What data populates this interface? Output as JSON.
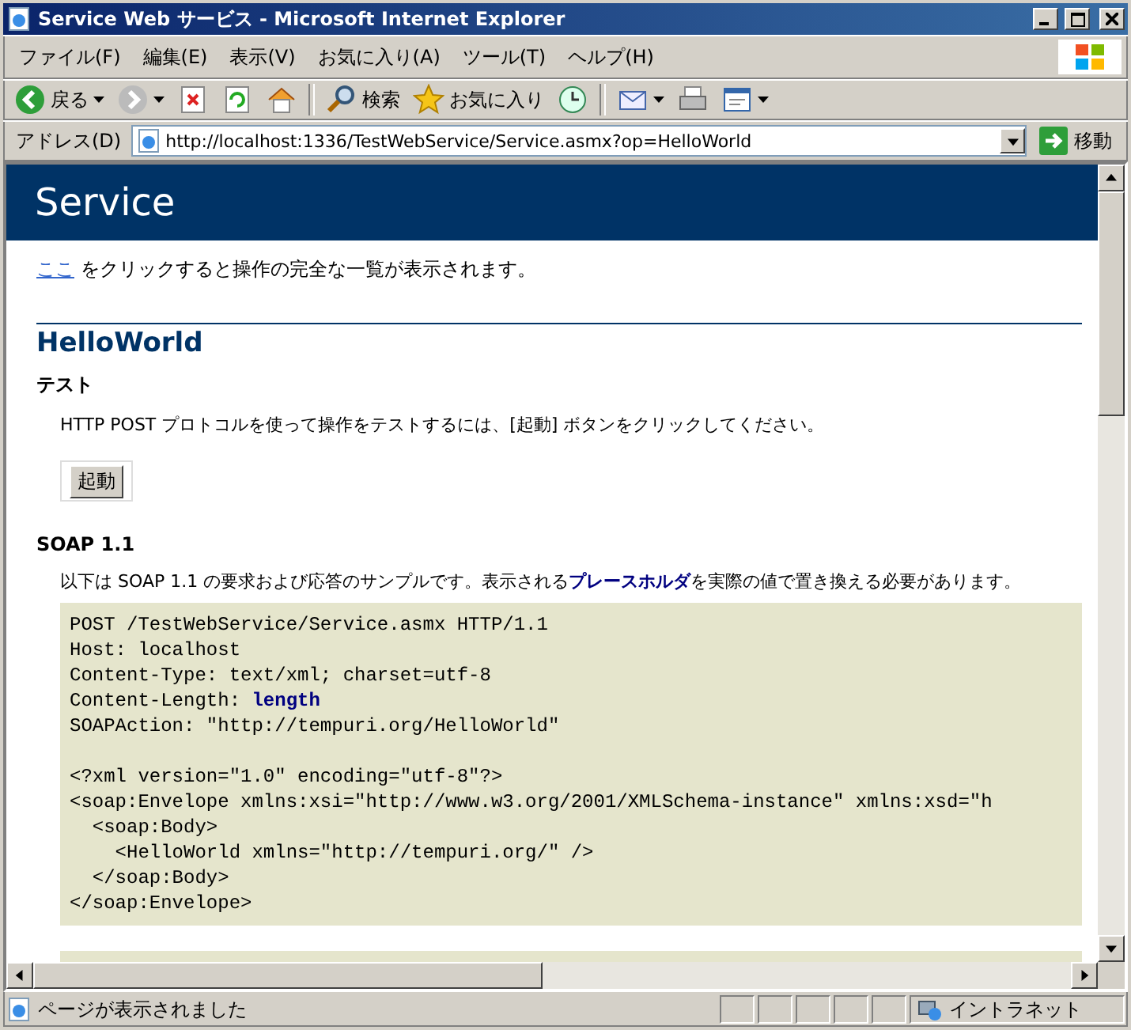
{
  "window": {
    "title": "Service Web サービス - Microsoft Internet Explorer"
  },
  "menu": [
    "ファイル(F)",
    "編集(E)",
    "表示(V)",
    "お気に入り(A)",
    "ツール(T)",
    "ヘルプ(H)"
  ],
  "toolbar": [
    {
      "kind": "back",
      "label": "戻る",
      "dropdown": true
    },
    {
      "kind": "forward",
      "dropdown": true
    },
    {
      "kind": "stop"
    },
    {
      "kind": "refresh"
    },
    {
      "kind": "home"
    },
    {
      "kind": "search",
      "label": "検索"
    },
    {
      "kind": "favorites",
      "label": "お気に入り"
    },
    {
      "kind": "history"
    },
    {
      "kind": "mail",
      "dropdown": true
    },
    {
      "kind": "print"
    },
    {
      "kind": "edit",
      "dropdown": true
    }
  ],
  "address": {
    "label": "アドレス(D)",
    "url": "http://localhost:1336/TestWebService/Service.asmx?op=HelloWorld",
    "go": "移動"
  },
  "page": {
    "title": "Service",
    "intro_link": "ここ",
    "intro_text": "をクリックすると操作の完全な一覧が表示されます。",
    "operation": "HelloWorld",
    "test_heading": "テスト",
    "test_text": "HTTP POST プロトコルを使って操作をテストするには、[起動] ボタンをクリックしてください。",
    "invoke_button": "起動",
    "soap_heading": "SOAP 1.1",
    "soap_text": "以下は SOAP 1.1 の要求および応答のサンプルです。表示される**プレースホルダ**を実際の値で置き換える必要があります。",
    "http_lines": [
      "POST /TestWebService/Service.asmx HTTP/1.1",
      "Host: localhost",
      "Content-Type: text/xml; charset=utf-8",
      "Content-Length: **length**",
      "SOAPAction: \"http://tempuri.org/HelloWorld\""
    ],
    "xml_lines": [
      "<?xml version=\"1.0\" encoding=\"utf-8\"?>",
      "<soap:Envelope xmlns:xsi=\"http://www.w3.org/2001/XMLSchema-instance\" xmlns:xsd=\"h",
      "  <soap:Body>",
      "    <HelloWorld xmlns=\"http://tempuri.org/\" />",
      "  </soap:Body>",
      "</soap:Envelope>"
    ]
  },
  "status": {
    "text": "ページが表示されました",
    "zone": "イントラネット"
  }
}
